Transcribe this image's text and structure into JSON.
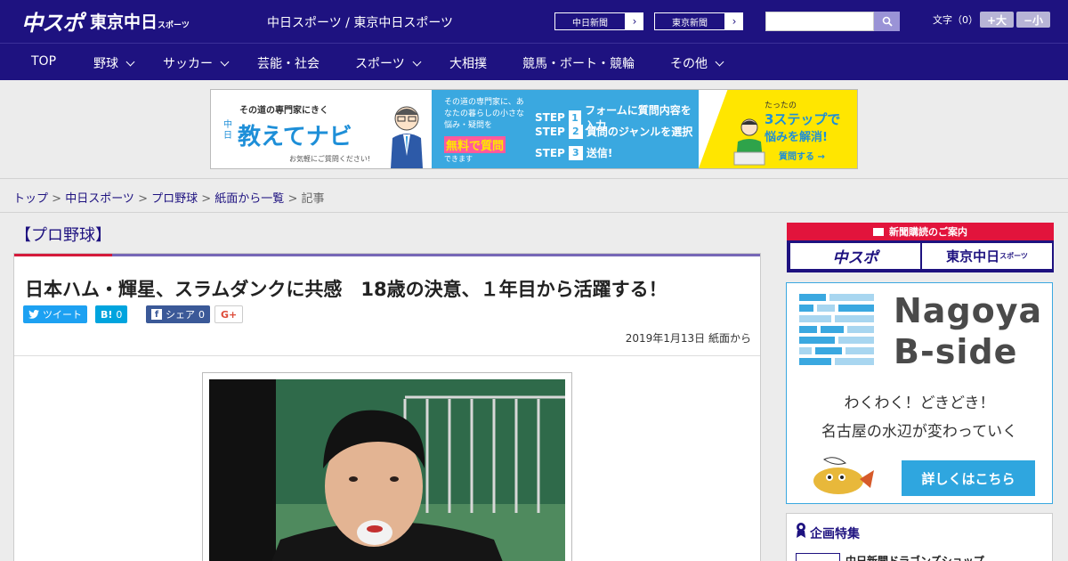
{
  "header": {
    "logo_main": "中スポ",
    "logo_sub": "東京中日",
    "logo_sub_small": "スポーツ",
    "site_title": "中日スポーツ / 東京中日スポーツ",
    "paper_links": [
      {
        "label": "中日新聞"
      },
      {
        "label": "東京新聞"
      }
    ],
    "search_placeholder": "",
    "font_size_label": "文字（0）",
    "font_bigger": "+大",
    "font_smaller": "−小"
  },
  "nav": {
    "items": [
      {
        "label": "TOP",
        "dropdown": false
      },
      {
        "label": "野球",
        "dropdown": true
      },
      {
        "label": "サッカー",
        "dropdown": true
      },
      {
        "label": "芸能・社会",
        "dropdown": false
      },
      {
        "label": "スポーツ",
        "dropdown": true
      },
      {
        "label": "大相撲",
        "dropdown": false
      },
      {
        "label": "競馬・ボート・競輪",
        "dropdown": false
      },
      {
        "label": "その他",
        "dropdown": true
      }
    ]
  },
  "banner": {
    "sub": "その道の専門家にきく",
    "vertical": "中日",
    "main": "教えてナビ",
    "caption": "お気軽にご質問ください!",
    "desc": "その道の専門家に、あなたの暮らしの小さな悩み・疑問を",
    "highlight": "無料で質問",
    "dek": "できます",
    "steps": [
      {
        "num": "1",
        "label": "STEP",
        "text": "フォームに質問内容を入力"
      },
      {
        "num": "2",
        "label": "STEP",
        "text": "質問のジャンルを選択"
      },
      {
        "num": "3",
        "label": "STEP",
        "text": "送信!"
      }
    ],
    "right_t1": "たったの",
    "right_t2": "3ステップで",
    "right_t3": "悩みを解消!",
    "right_cta": "質問する →"
  },
  "breadcrumb": {
    "items": [
      "トップ",
      "中日スポーツ",
      "プロ野球",
      "紙面から一覧"
    ],
    "current": "記事",
    "separator": " > "
  },
  "article": {
    "category": "【プロ野球】",
    "headline": "日本ハム・輝星、スラムダンクに共感　18歳の決意、１年目から活躍する！",
    "share": {
      "tweet": "ツイート",
      "hatena_label": "B!",
      "hatena_count": "0",
      "facebook_label": "シェア",
      "facebook_count": "0",
      "gplus": "G+"
    },
    "date": "2019年1月13日 紙面から"
  },
  "sidebar": {
    "subscription_head": "新聞購読のご案内",
    "sub_btn1": "中スポ",
    "sub_btn2": "東京中日",
    "sub_btn2_small": "スポーツ",
    "bside_title_1": "Nagoya",
    "bside_title_2": "B-side",
    "bside_tag1": "わくわく！どきどき！",
    "bside_tag2": "名古屋の水辺が変わっていく",
    "bside_btn": "詳しくはこちら",
    "feature_title": "企画特集",
    "feature_item": "中日新聞ドラゴンズショップ"
  },
  "colors": {
    "brand_navy": "#1e1280",
    "accent_red": "#d51a3b",
    "accent_purple": "#7667b7",
    "sky_blue": "#3aa8e0",
    "banner_yellow": "#ffe600",
    "twitter": "#1da1f2",
    "hatena": "#00a4de",
    "facebook": "#3b5998"
  }
}
